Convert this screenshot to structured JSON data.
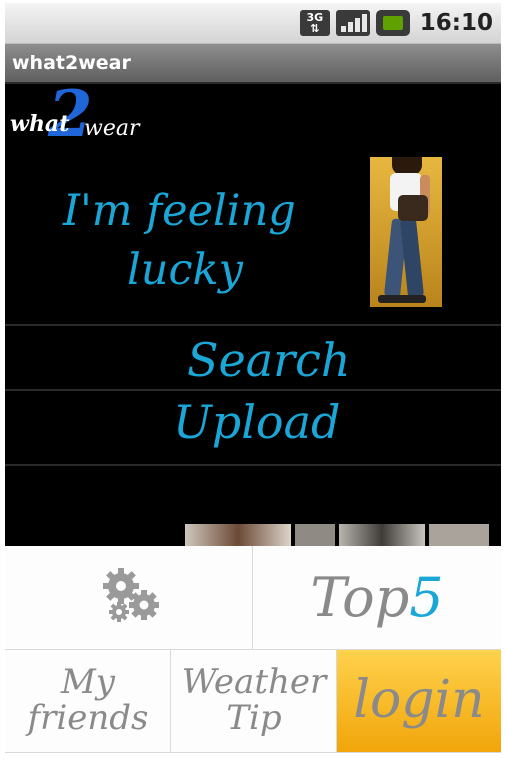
{
  "status_bar": {
    "network": "3G",
    "time": "16:10"
  },
  "app": {
    "title": "what2wear"
  },
  "logo": {
    "prefix": "what",
    "number": "2",
    "suffix": "wear"
  },
  "menu": {
    "feeling_lucky_line1": "I'm  feeling",
    "feeling_lucky_line2": "lucky",
    "search": "Search",
    "upload": "Upload"
  },
  "bottom_bar": {
    "top5_prefix": "Top",
    "top5_number": "5",
    "my_friends_line1": "My",
    "my_friends_line2": "friends",
    "weather_tip_line1": "Weather",
    "weather_tip_line2": "Tip",
    "login": "login"
  },
  "colors": {
    "accent": "#1aa7d8",
    "logo_blue": "#1f66d8",
    "login_bg": "#f7b928",
    "background": "#000000"
  },
  "icons": [
    "network-3g-icon",
    "signal-icon",
    "battery-icon",
    "settings-gears-icon"
  ]
}
